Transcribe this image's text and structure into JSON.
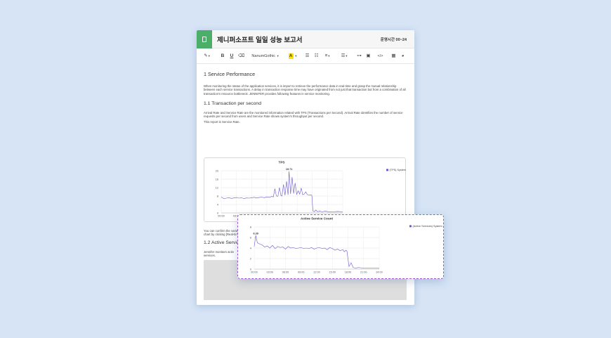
{
  "document": {
    "title": "제니퍼소프트 일일 성능 보고서",
    "hours_label": "운영시간 00~24"
  },
  "toolbar": {
    "font_name": "NanumGothic",
    "bold": "B",
    "underline": "U",
    "highlight": "A"
  },
  "content": {
    "h1": "1 Service Performance",
    "p1": "When monitoring the status of the application services, it is import to retrieve the performance data in real-time and grasp the mutual relationship between each service transactions. A delay in transaction response time may have originated from not just that transaction but from a combination of all transaction's resource bottleneck. JENNIFER provides following features in service monitoring.",
    "h2_tps": "1.1 Transaction per second",
    "p2": "Arrival Rate and Service Rate are the monitored information related with TPS (Transactions per Second). Arrival Rate identifies the number of service requests per second from users and Service Rate shows system's throughput per second.",
    "p3": "This report is Service Rate.",
    "p4": "You can confirm the variation of Arrival Rate through Today's Arrival Rate (tps), Recent Total Arrival Rate (tps) and Recent Arrival Rate per server (tps) chart by clicking [Real-time Monitoring]-[Throughput] menu.",
    "h2_active": "1.2 Active Services",
    "p5_line1": "Jennifer monitors activ",
    "p5_line2": "services."
  },
  "chart_data": [
    {
      "type": "line",
      "title": "TPS",
      "legend": "(TPS) System",
      "legend_position": "top-right",
      "x_ticks": [
        "00:00",
        "03:00",
        "06:00",
        "09:00",
        "12:00",
        "15:00",
        "18:00",
        "21:00",
        "24:00"
      ],
      "y_ticks": [
        0,
        4,
        8,
        12,
        16,
        20
      ],
      "xlim": [
        0,
        24
      ],
      "ylim": [
        0,
        20
      ],
      "grid": true,
      "peak_label": "19.71",
      "series": [
        {
          "name": "(TPS) System",
          "color": "#6a5acd",
          "x": [
            0,
            0.5,
            1,
            1.5,
            2,
            2.5,
            3,
            3.5,
            4,
            4.5,
            5,
            5.5,
            6,
            6.5,
            7,
            7.5,
            8,
            8.5,
            9,
            9.5,
            10,
            10.3,
            10.6,
            10.9,
            11.2,
            11.5,
            11.8,
            12,
            12.3,
            12.6,
            12.9,
            13.2,
            13.4,
            13.7,
            14,
            14.3,
            14.6,
            14.9,
            15.2,
            15.5,
            15.8,
            16.1,
            16.4,
            16.7,
            17,
            17.3,
            17.6,
            17.9,
            18.1,
            18.4,
            18.7,
            19,
            19.5,
            20,
            20.5,
            21,
            22,
            23,
            24
          ],
          "y": [
            7.6,
            6.8,
            7.0,
            7.2,
            6.9,
            7.1,
            7.3,
            7.0,
            7.2,
            6.8,
            7.1,
            7.0,
            7.2,
            7.4,
            7.1,
            7.3,
            7.5,
            7.2,
            7.6,
            7.4,
            7.8,
            7.6,
            11.5,
            8.0,
            7.9,
            12.0,
            8.2,
            8.0,
            13.5,
            8.4,
            15.0,
            8.6,
            19.71,
            9.0,
            17.0,
            9.2,
            14.2,
            8.8,
            10.5,
            8.9,
            11.8,
            8.6,
            9.0,
            10.0,
            8.7,
            8.5,
            8.6,
            8.4,
            1.0,
            0.6,
            1.4,
            0.6,
            0.8,
            0.5,
            0.9,
            0.6,
            0.5,
            0.7,
            0.5
          ]
        }
      ]
    },
    {
      "type": "line",
      "title": "Active Service Count",
      "legend": "(Active Services) System",
      "legend_position": "top-right",
      "x_ticks": [
        "00:00",
        "03:00",
        "06:00",
        "09:00",
        "12:00",
        "15:00",
        "18:00",
        "21:00",
        "24:00"
      ],
      "y_ticks": [
        0,
        2,
        4,
        6,
        8
      ],
      "xlim": [
        0,
        24
      ],
      "ylim": [
        0,
        8
      ],
      "grid": true,
      "peak_label": "6.39",
      "series": [
        {
          "name": "(Active Services) System",
          "color": "#6a5acd",
          "x": [
            0,
            0.3,
            0.6,
            1,
            1.5,
            2,
            2.5,
            3,
            3.5,
            4,
            4.5,
            5,
            5.5,
            6,
            6.5,
            7,
            7.5,
            8,
            8.5,
            9,
            9.5,
            10,
            10.5,
            11,
            11.5,
            12,
            12.5,
            13,
            13.5,
            14,
            14.5,
            15,
            15.5,
            16,
            16.5,
            17,
            17.3,
            17.6,
            17.8,
            18.2,
            18.6,
            19,
            19.5,
            20,
            21,
            22,
            23,
            24
          ],
          "y": [
            4.3,
            6.39,
            5.0,
            4.8,
            4.6,
            4.2,
            4.4,
            4.0,
            4.5,
            3.9,
            4.3,
            4.1,
            4.2,
            3.8,
            4.3,
            4.0,
            4.1,
            3.9,
            4.0,
            4.1,
            3.9,
            4.0,
            3.9,
            4.1,
            3.8,
            4.0,
            4.1,
            3.9,
            4.0,
            3.7,
            4.1,
            3.9,
            3.6,
            3.8,
            3.5,
            3.7,
            3.3,
            3.6,
            3.4,
            0.5,
            1.2,
            0.3,
            0.2,
            0.3,
            0.2,
            0.2,
            0.2,
            0.2
          ]
        }
      ]
    }
  ]
}
